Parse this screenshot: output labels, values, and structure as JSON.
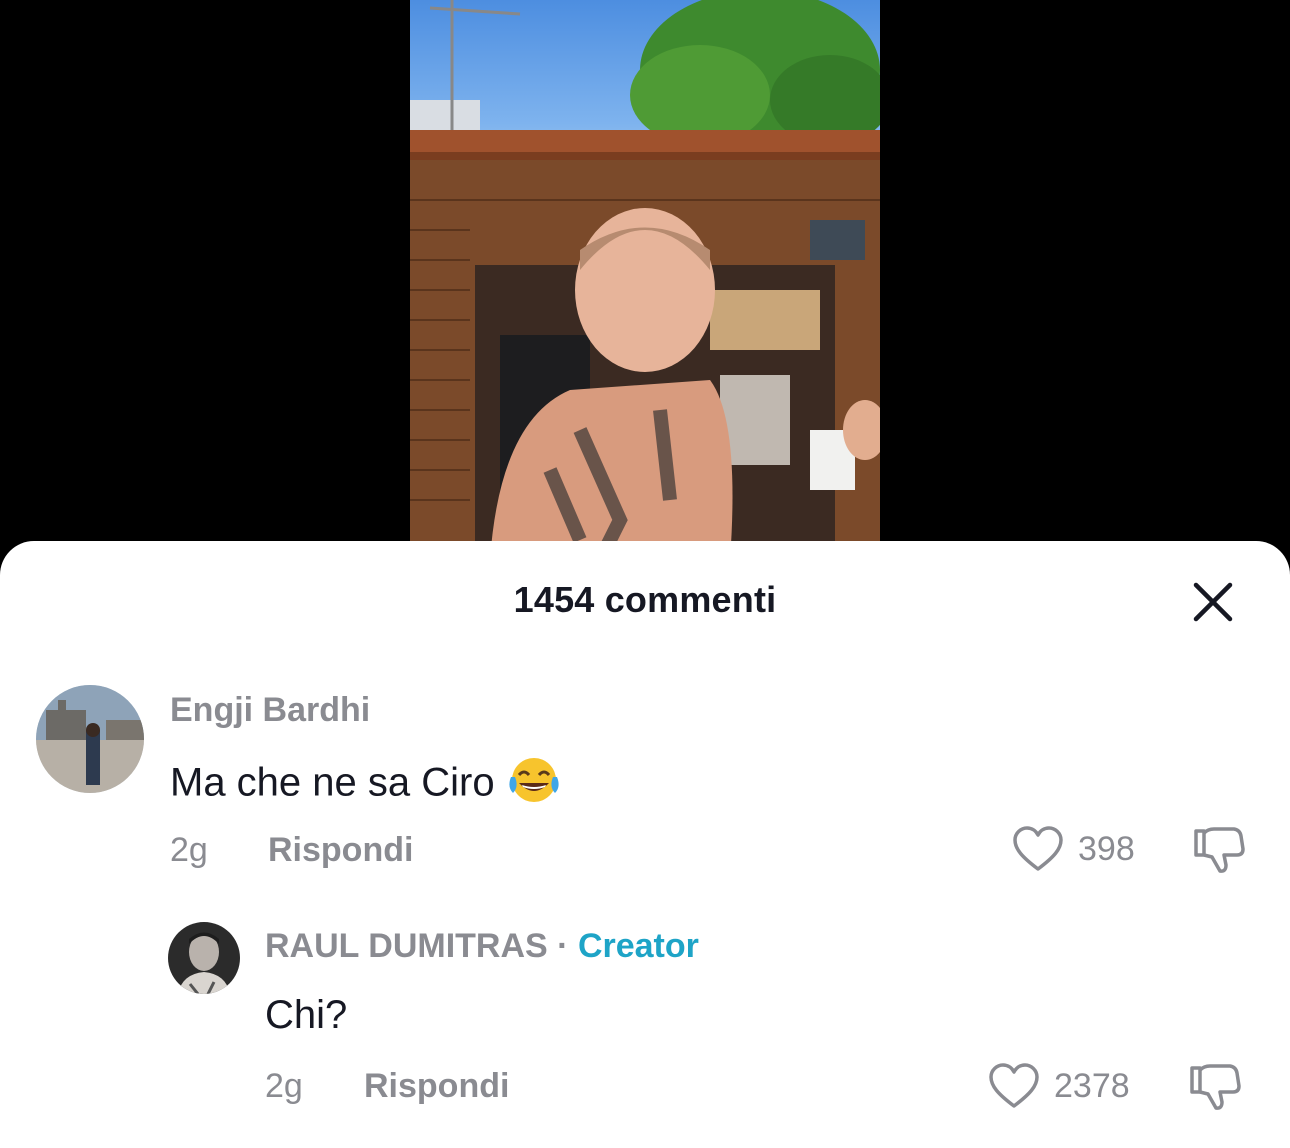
{
  "sheet": {
    "title": "1454 commenti"
  },
  "comments": [
    {
      "author": "Engji Bardhi",
      "text": "Ma che ne sa Ciro",
      "emoji_icon": "face-with-tears-of-joy-icon",
      "time": "2g",
      "reply_label": "Rispondi",
      "likes": "398"
    }
  ],
  "reply": {
    "author": "RAUL DUMITRAS",
    "separator": "·",
    "badge": "Creator",
    "text": "Chi?",
    "time": "2g",
    "reply_label": "Rispondi",
    "likes": "2378"
  },
  "colors": {
    "accent_creator": "#1ea4c7",
    "secondary_text": "#8a8b91",
    "primary_text": "#161823"
  }
}
